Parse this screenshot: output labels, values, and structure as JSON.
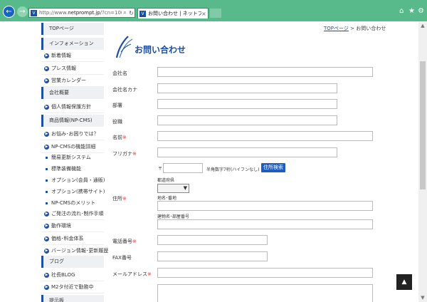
{
  "browser": {
    "url_prefix": "http://www.",
    "url_domain": "netprompt.jp",
    "url_suffix": "/?cn=100005",
    "tab_title": "お問い合わせ | ネットプロンプ...",
    "favicon": "V",
    "icons": [
      "back-arrow-icon",
      "forward-arrow-icon",
      "search-icon",
      "refresh-icon",
      "home-icon",
      "star-icon",
      "gear-icon"
    ]
  },
  "sidebar": {
    "categories": [
      {
        "label": "TOPページ"
      },
      {
        "label": "インフォメーション"
      },
      {
        "label": "会社概要"
      },
      {
        "label": "商品情報(NP-CMS)"
      },
      {
        "label": "ブログ"
      },
      {
        "label": "提示板"
      }
    ],
    "items": [
      {
        "label": "新着情報"
      },
      {
        "label": "プレス情報"
      },
      {
        "label": "営業カレンダー"
      },
      {
        "label": "個人情報保護方針"
      },
      {
        "label": "お悩み･お困りでは？"
      },
      {
        "label": "NP-CMSの機能詳細"
      },
      {
        "label": "ご発注の流れ･制作手順"
      },
      {
        "label": "動作環境"
      },
      {
        "label": "価格･料金体系"
      },
      {
        "label": "バージョン情報･更新履歴"
      },
      {
        "label": "社長BLOG"
      },
      {
        "label": "M2タ付近で勤務中"
      }
    ],
    "subitems": [
      {
        "label": "簡易更新システム"
      },
      {
        "label": "標準装備機能"
      },
      {
        "label": "オプション(会員・通販)"
      },
      {
        "label": "オプション(携帯サイト)"
      },
      {
        "label": "NP-CMSのメリット"
      }
    ]
  },
  "breadcrumb": {
    "home": "TOPページ",
    "separator": " > ",
    "current": "お問い合わせ"
  },
  "page": {
    "title": "お問い合わせ"
  },
  "form": {
    "required_mark": "※",
    "fields": {
      "company": "会社名",
      "company_kana": "会社名カナ",
      "department": "部署",
      "position": "役職",
      "name": "名前",
      "furigana": "フリガナ",
      "address": "住所",
      "phone": "電話番号",
      "fax": "FAX番号",
      "email": "メールアドレス"
    },
    "zip_prefix": "〒",
    "zip_hint": "半角数字7桁(ハイフンなし)",
    "zip_button": "住所検索",
    "prefecture_label": "都道府県",
    "city_label": "地名･番地",
    "building_label": "建物名･部屋番号"
  },
  "to_top": "▲"
}
